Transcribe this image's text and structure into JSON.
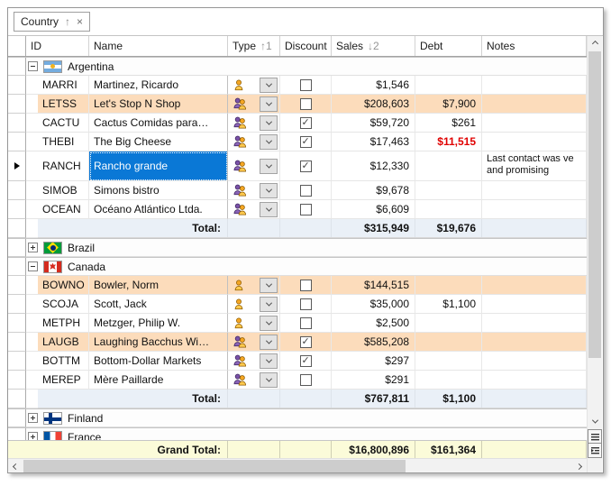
{
  "group_panel": {
    "field_label": "Country",
    "sort_glyph": "↑",
    "remove_glyph": "×"
  },
  "columns": [
    {
      "key": "id",
      "label": "ID"
    },
    {
      "key": "name",
      "label": "Name"
    },
    {
      "key": "type",
      "label": "Type",
      "sort_glyph": "↑",
      "sort_order": "1"
    },
    {
      "key": "discount",
      "label": "Discount"
    },
    {
      "key": "sales",
      "label": "Sales",
      "sort_glyph": "↓",
      "sort_order": "2"
    },
    {
      "key": "debt",
      "label": "Debt"
    },
    {
      "key": "notes",
      "label": "Notes"
    }
  ],
  "total_label": "Total:",
  "rows": [
    {
      "type": "group",
      "label": "Argentina",
      "flag": "argentina",
      "expanded": true
    },
    {
      "type": "data",
      "id": "MARRI",
      "name": "Martinez, Ricardo",
      "customer_type": "person",
      "discount": false,
      "sales": "$1,546",
      "debt": ""
    },
    {
      "type": "data",
      "id": "LETSS",
      "name": "Let's Stop N Shop",
      "customer_type": "company",
      "discount": false,
      "sales": "$208,603",
      "debt": "$7,900",
      "highlight": true
    },
    {
      "type": "data",
      "id": "CACTU",
      "name": "Cactus Comidas para…",
      "customer_type": "company",
      "discount": true,
      "sales": "$59,720",
      "debt": "$261"
    },
    {
      "type": "data",
      "id": "THEBI",
      "name": "The Big Cheese",
      "customer_type": "company",
      "discount": true,
      "sales": "$17,463",
      "debt": "$11,515",
      "debt_negative": true
    },
    {
      "type": "data",
      "id": "RANCH",
      "name": "Rancho grande",
      "customer_type": "company",
      "discount": true,
      "sales": "$12,330",
      "debt": "",
      "notes_lines": [
        "Last contact was ve",
        "and promising"
      ],
      "focused": true,
      "name_selected": true,
      "tall": true
    },
    {
      "type": "data",
      "id": "SIMOB",
      "name": "Simons bistro",
      "customer_type": "company",
      "discount": false,
      "sales": "$9,678",
      "debt": ""
    },
    {
      "type": "data",
      "id": "OCEAN",
      "name": "Océano Atlántico Ltda.",
      "customer_type": "company",
      "discount": false,
      "sales": "$6,609",
      "debt": ""
    },
    {
      "type": "total",
      "sales": "$315,949",
      "debt": "$19,676"
    },
    {
      "type": "group",
      "label": "Brazil",
      "flag": "brazil",
      "expanded": false
    },
    {
      "type": "group",
      "label": "Canada",
      "flag": "canada",
      "expanded": true
    },
    {
      "type": "data",
      "id": "BOWNO",
      "name": "Bowler, Norm",
      "customer_type": "person",
      "discount": false,
      "sales": "$144,515",
      "debt": "",
      "highlight": true
    },
    {
      "type": "data",
      "id": "SCOJA",
      "name": "Scott, Jack",
      "customer_type": "person",
      "discount": false,
      "sales": "$35,000",
      "debt": "$1,100"
    },
    {
      "type": "data",
      "id": "METPH",
      "name": "Metzger, Philip W.",
      "customer_type": "person",
      "discount": false,
      "sales": "$2,500",
      "debt": ""
    },
    {
      "type": "data",
      "id": "LAUGB",
      "name": "Laughing Bacchus Wi…",
      "customer_type": "company",
      "discount": true,
      "sales": "$585,208",
      "debt": "",
      "highlight": true
    },
    {
      "type": "data",
      "id": "BOTTM",
      "name": "Bottom-Dollar Markets",
      "customer_type": "company",
      "discount": true,
      "sales": "$297",
      "debt": ""
    },
    {
      "type": "data",
      "id": "MEREP",
      "name": "Mère Paillarde",
      "customer_type": "company",
      "discount": false,
      "sales": "$291",
      "debt": ""
    },
    {
      "type": "total",
      "sales": "$767,811",
      "debt": "$1,100"
    },
    {
      "type": "group",
      "label": "Finland",
      "flag": "finland",
      "expanded": false
    },
    {
      "type": "group",
      "label": "France",
      "flag": "france",
      "expanded": false
    }
  ],
  "grand_total": {
    "label": "Grand Total:",
    "sales": "$16,800,896",
    "debt": "$161,364"
  },
  "colors": {
    "selection": "#0a78d6",
    "row_highlight": "#fcdcbb",
    "group_total_bg": "#eaf0f7",
    "grand_total_bg": "#fbfbd9",
    "debt_negative": "#e00000"
  }
}
